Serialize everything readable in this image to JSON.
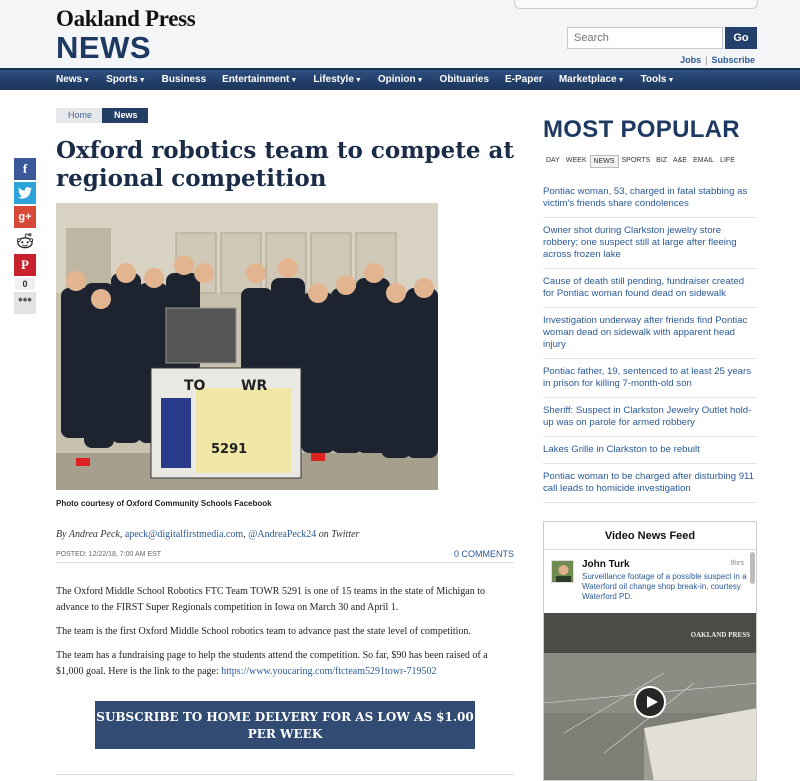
{
  "header": {
    "brand_top": "Oakland Press",
    "brand_news": "NEWS",
    "search_placeholder": "Search",
    "search_button": "Go",
    "links": [
      "Jobs",
      "Subscribe"
    ]
  },
  "nav": [
    {
      "label": "News",
      "caret": true
    },
    {
      "label": "Sports",
      "caret": true
    },
    {
      "label": "Business",
      "caret": false
    },
    {
      "label": "Entertainment",
      "caret": true
    },
    {
      "label": "Lifestyle",
      "caret": true
    },
    {
      "label": "Opinion",
      "caret": true
    },
    {
      "label": "Obituaries",
      "caret": false
    },
    {
      "label": "E-Paper",
      "caret": false
    },
    {
      "label": "Marketplace",
      "caret": true
    },
    {
      "label": "Tools",
      "caret": true
    }
  ],
  "breadcrumb": {
    "home": "Home",
    "current": "News"
  },
  "share": {
    "count": "0",
    "more": "•••"
  },
  "article": {
    "headline": "Oxford robotics team to compete at regional competition",
    "caption": "Photo courtesy of Oxford Community Schools Facebook",
    "byline_prefix": "By Andrea Peck,",
    "email": "apeck@digitalfirstmedia.com",
    "byline_mid": ",",
    "twitter": "@AndreaPeck24",
    "byline_suffix": "on Twitter",
    "posted": "POSTED: 12/22/18, 7:00 AM EST",
    "comments": "0 COMMENTS",
    "p1": "The Oxford Middle School Robotics FTC Team TOWR 5291 is one of 15 teams in the state of Michigan to advance to the FIRST Super Regionals competition in Iowa on March 30 and April 1.",
    "p2": "The team is the first Oxford Middle School robotics team to advance past the state level of competition.",
    "p3": "The team has a fundraising page to help the students attend the competition. So far, $90 has been raised of a $1,000 goal. Here is the link to the page:",
    "p3_link": "https://www.youcaring.com/ftcteam5291towr-719502",
    "subscribe": "SUBSCRIBE TO HOME DELVERY FOR AS LOW AS $1.00 PER WEEK",
    "photo_board_text": [
      "TO",
      "WR",
      "5291"
    ]
  },
  "most_popular": {
    "title": "MOST POPULAR",
    "tabs": [
      "DAY",
      "WEEK",
      "NEWS",
      "SPORTS",
      "BIZ",
      "A&E",
      "EMAIL",
      "LIFE"
    ],
    "active_tab": "NEWS",
    "items": [
      "Pontiac woman, 53, charged in fatal stabbing as victim's friends share condolences",
      "Owner shot during Clarkston jewelry store robbery; one suspect still at large after fleeing across frozen lake",
      "Cause of death still pending, fundraiser created for Pontiac woman found dead on sidewalk",
      "Investigation underway after friends find Pontiac woman dead on sidewalk with apparent head injury",
      "Pontiac father, 19, sentenced to at least 25 years in prison for killing 7-month-old son",
      "Sheriff: Suspect in Clarkston Jewelry Outlet hold-up was on parole for armed robbery",
      "Lakes Grille in Clarkston to be rebuilt",
      "Pontiac woman to be charged after disturbing 911 call leads to homicide investigation"
    ]
  },
  "video_feed": {
    "title": "Video News Feed",
    "author": "John Turk",
    "time": "9hrs",
    "text": "Surveillance footage of a possible suspect in a Waterford oil change shop break-in, courtesy Waterford PD.",
    "watermark": "OAKLAND PRESS"
  }
}
